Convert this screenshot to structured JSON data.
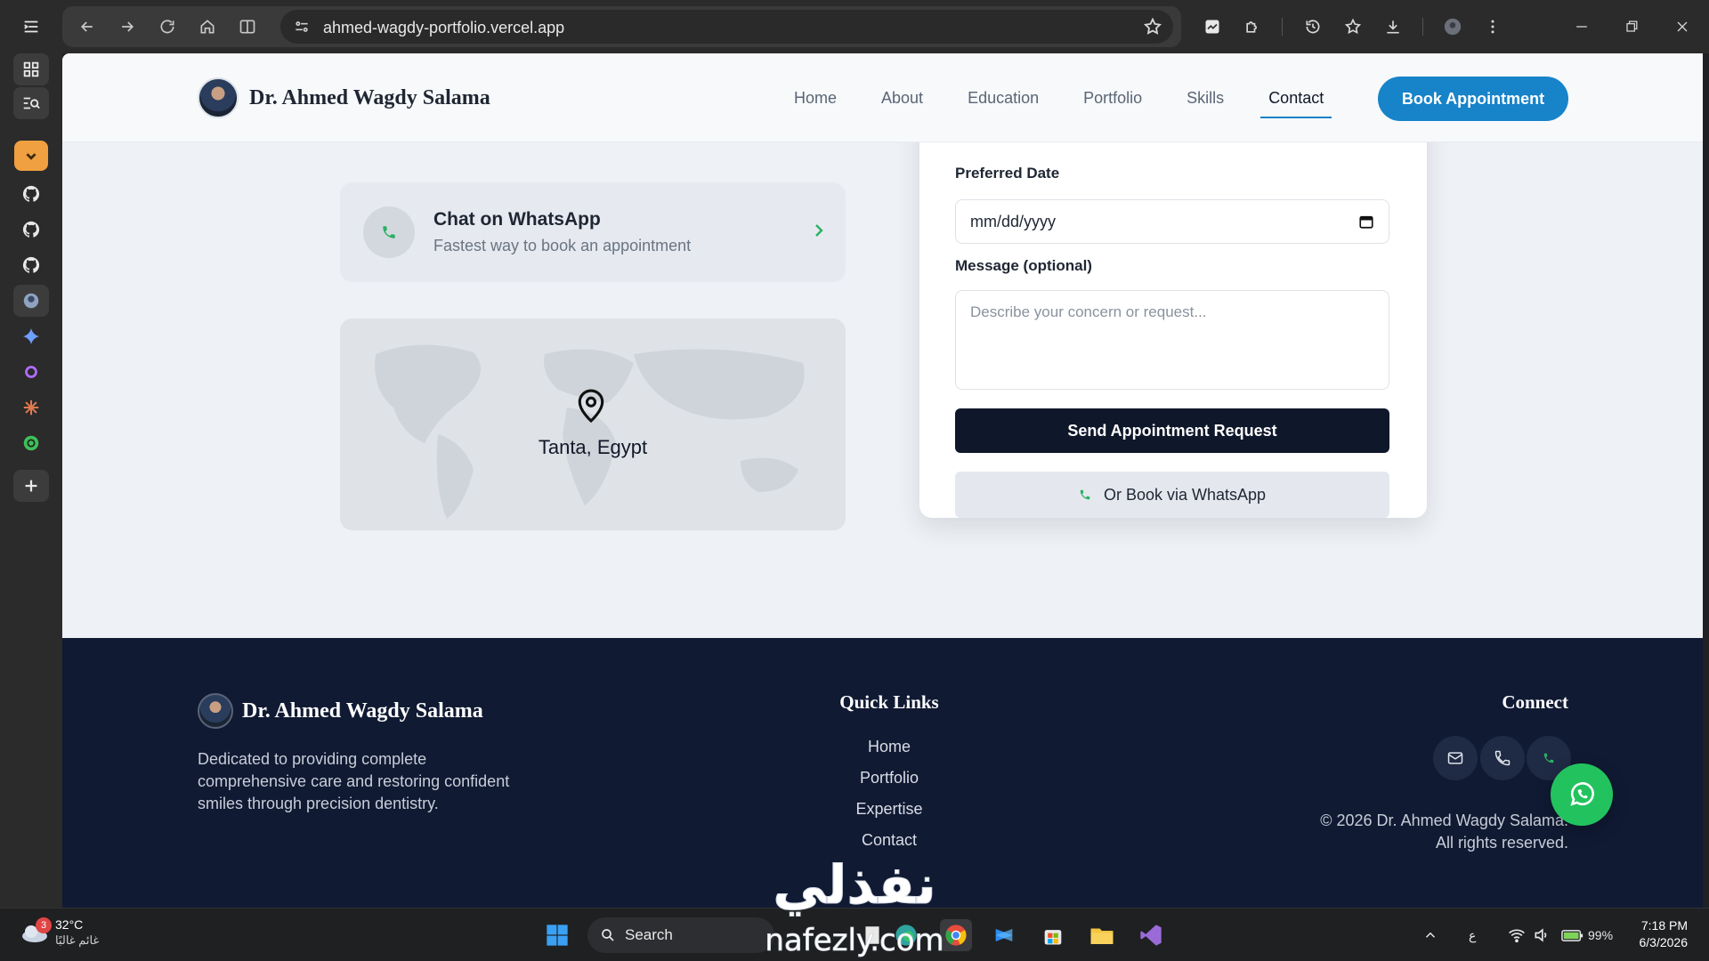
{
  "browser": {
    "url": "ahmed-wagdy-portfolio.vercel.app"
  },
  "header": {
    "brand_name": "Dr. Ahmed Wagdy Salama",
    "nav": [
      "Home",
      "About",
      "Education",
      "Portfolio",
      "Skills",
      "Contact"
    ],
    "active_nav": "Contact",
    "cta_label": "Book Appointment"
  },
  "contact": {
    "whatsapp_title": "Chat on WhatsApp",
    "whatsapp_subtitle": "Fastest way to book an appointment",
    "location": "Tanta, Egypt"
  },
  "form": {
    "date_label": "Preferred Date",
    "date_placeholder": "mm/dd/yyyy",
    "message_label": "Message (optional)",
    "message_placeholder": "Describe your concern or request...",
    "submit_label": "Send Appointment Request",
    "whatsapp_label": "Or Book via WhatsApp"
  },
  "footer": {
    "brand_name": "Dr. Ahmed Wagdy Salama",
    "description": "Dedicated to providing complete comprehensive care and restoring confident smiles through precision dentistry.",
    "quick_links_title": "Quick Links",
    "quick_links": [
      "Home",
      "Portfolio",
      "Expertise",
      "Contact"
    ],
    "connect_title": "Connect",
    "copyright_line1": "© 2026 Dr. Ahmed Wagdy Salama.",
    "copyright_line2": "All rights reserved."
  },
  "watermark": {
    "arabic": "نفذلي",
    "latin": "nafezly.com"
  },
  "taskbar": {
    "weather_badge": "3",
    "temperature": "32°C",
    "weather_condition": "غائم غالبًا",
    "search_label": "Search",
    "ime": "ع",
    "battery": "99%",
    "time": "7:18 PM",
    "date": "6/3/2026"
  },
  "colors": {
    "primary": "#1783c9",
    "footer_bg": "#101a33",
    "whatsapp_green": "#22c35e",
    "button_dark": "#0f172a"
  }
}
